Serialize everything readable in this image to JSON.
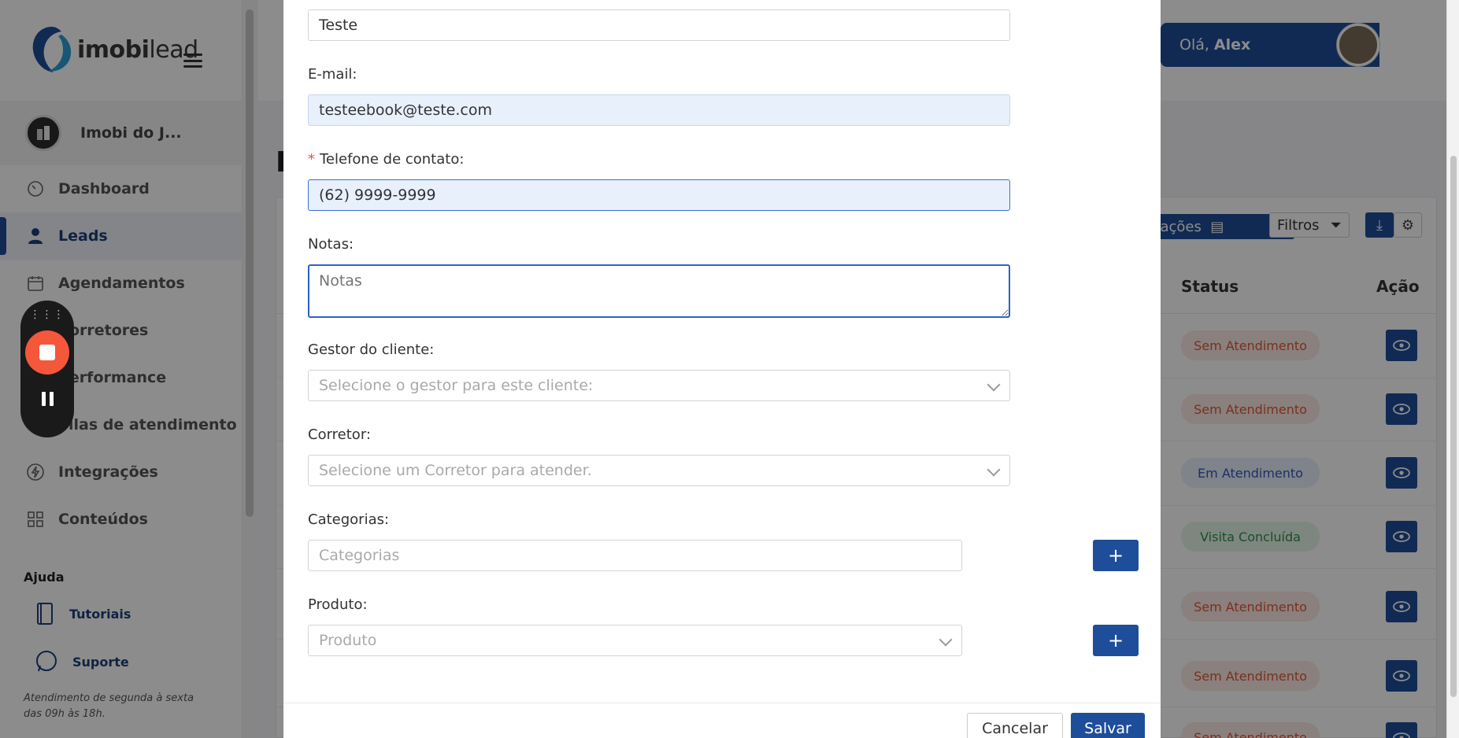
{
  "brand": {
    "logo_bold": "imobi",
    "logo_light": "lead",
    "accent": "#1e4e9a"
  },
  "sidebar": {
    "company_name": "Imobi do J...",
    "items": [
      {
        "label": "Dashboard",
        "icon": "speedometer-icon"
      },
      {
        "label": "Leads",
        "icon": "person-icon",
        "active": true
      },
      {
        "label": "Agendamentos",
        "icon": "calendar-icon"
      },
      {
        "label": "Corretores",
        "icon": "people-icon"
      },
      {
        "label": "Performance",
        "icon": "chart-icon"
      },
      {
        "label": "Filas de atendimento",
        "icon": "queue-icon"
      },
      {
        "label": "Integrações",
        "icon": "lightning-icon"
      },
      {
        "label": "Conteúdos",
        "icon": "grid-icon"
      }
    ],
    "help": {
      "title": "Ajuda",
      "tutorials": "Tutoriais",
      "support": "Suporte",
      "note": "Atendimento de segunda à sexta das 09h às 18h."
    }
  },
  "header": {
    "greeting": "Olá,",
    "user": "Alex"
  },
  "background": {
    "page_title": "L",
    "import_label": "ortações",
    "filter_label": "Filtros",
    "columns": {
      "status": "Status",
      "action": "Ação"
    },
    "rows": [
      {
        "status": "Sem Atendimento",
        "kind": "sem"
      },
      {
        "status": "Sem Atendimento",
        "kind": "sem"
      },
      {
        "status": "Em Atendimento",
        "kind": "em"
      },
      {
        "status": "Visita Concluída",
        "kind": "vis"
      },
      {
        "status": "Sem Atendimento",
        "kind": "sem"
      },
      {
        "status": "Sem Atendimento",
        "kind": "sem"
      },
      {
        "status": "Sem Atendimento",
        "kind": "sem"
      }
    ]
  },
  "modal": {
    "name_value": "Teste",
    "email_label": "E-mail:",
    "email_value": "testeebook@teste.com",
    "phone_label": "Telefone de contato:",
    "phone_value": "(62) 9999-9999",
    "notes_label": "Notas:",
    "notes_placeholder": "Notas",
    "manager_label": "Gestor do cliente:",
    "manager_placeholder": "Selecione o gestor para este cliente:",
    "broker_label": "Corretor:",
    "broker_placeholder": "Selecione um Corretor para atender.",
    "categories_label": "Categorias:",
    "categories_placeholder": "Categorias",
    "product_label": "Produto:",
    "product_placeholder": "Produto",
    "add_symbol": "+",
    "cancel_label": "Cancelar",
    "save_label": "Salvar"
  }
}
